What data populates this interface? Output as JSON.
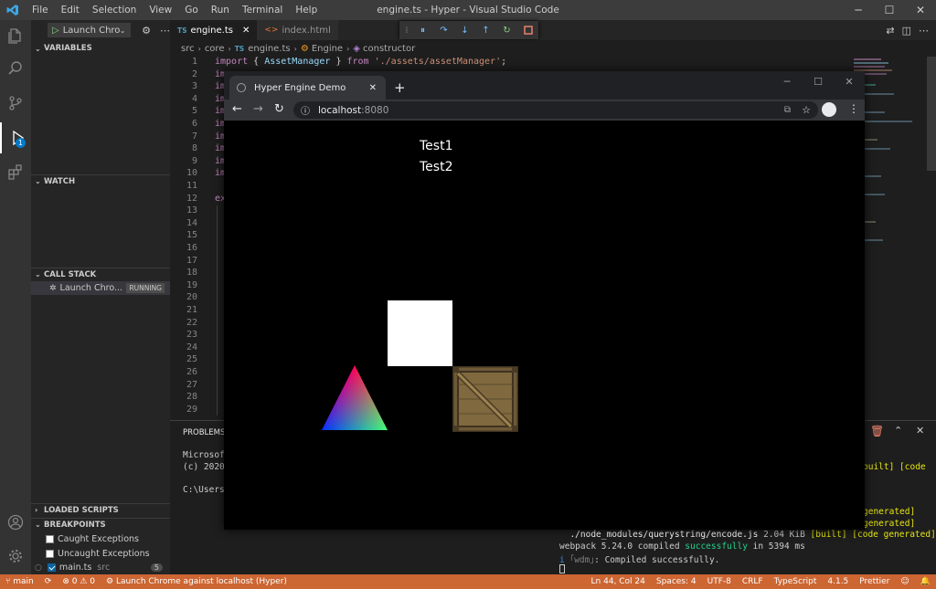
{
  "window": {
    "title": "engine.ts - Hyper - Visual Studio Code",
    "menu": [
      "File",
      "Edit",
      "Selection",
      "View",
      "Go",
      "Run",
      "Terminal",
      "Help"
    ]
  },
  "activity": {
    "icons": [
      "files-icon",
      "search-icon",
      "source-control-icon",
      "run-debug-icon",
      "extensions-icon"
    ],
    "debug_badge": "1"
  },
  "sidebar": {
    "launch_config": "Launch Chrom",
    "sections": {
      "variables": "VARIABLES",
      "watch": "WATCH",
      "call_stack": "CALL STACK",
      "loaded_scripts": "LOADED SCRIPTS",
      "breakpoints": "BREAKPOINTS"
    },
    "call_stack_item": {
      "label": "Launch Chro...",
      "status": "RUNNING"
    },
    "breakpoints": [
      {
        "label": "Caught Exceptions",
        "checked": false
      },
      {
        "label": "Uncaught Exceptions",
        "checked": false
      },
      {
        "label": "main.ts",
        "detail": "src",
        "count": "5",
        "checked": true
      }
    ]
  },
  "tabs": [
    {
      "label": "engine.ts",
      "icon": "TS",
      "active": true
    },
    {
      "label": "index.html",
      "icon": "<>",
      "active": false
    }
  ],
  "breadcrumb": [
    "src",
    "core",
    "engine.ts",
    "Engine",
    "constructor"
  ],
  "editor": {
    "line_numbers": [
      "1",
      "2",
      "3",
      "4",
      "5",
      "6",
      "7",
      "8",
      "9",
      "10",
      "11",
      "12",
      "13",
      "14",
      "15",
      "16",
      "17",
      "18",
      "19",
      "20",
      "21",
      "22",
      "23",
      "24",
      "25",
      "26",
      "27",
      "28",
      "29"
    ],
    "line1": {
      "kw": "import",
      "p1": " { ",
      "id": "AssetManager",
      "p2": " } ",
      "from": "from",
      "str": " './assets/assetManager'",
      "end": ";"
    },
    "line_im": "im",
    "line_ex": "ex"
  },
  "panel": {
    "tab": "PROBLEMS",
    "terminal": {
      "ms1": "Microsoft",
      "ms2": "(c) 2020",
      "cwd": "C:\\Users\\",
      "built": "built] [code",
      "gen1": "generated]",
      "gen2": "generated]",
      "qs_path": "  ./node_modules/querystring/encode.js",
      "qs_size": " 2.04 KiB ",
      "qs_tags": "[built] [code generated]",
      "wp_pre": "webpack 5.24.0 compiled ",
      "wp_ok": "successfully",
      "wp_post": " in 5394 ms",
      "wdm_i": "i",
      "wdm": " ｢wdm｣",
      "wdm_msg": ": Compiled successfully."
    }
  },
  "statusbar": {
    "branch": "main",
    "errors": "0",
    "warnings": "0",
    "launch": "Launch Chrome against localhost (Hyper)",
    "position": "Ln 44, Col 24",
    "spaces": "Spaces: 4",
    "encoding": "UTF-8",
    "eol": "CRLF",
    "language": "TypeScript",
    "ts_version": "4.1.5",
    "formatter": "Prettier"
  },
  "browser": {
    "tab_title": "Hyper Engine Demo",
    "url_host": "localhost",
    "url_port": ":8080",
    "text1": "Test1",
    "text2": "Test2"
  },
  "colors": {
    "statusbar": "#cc6633",
    "editor_bg": "#1e1e1e",
    "sidebar_bg": "#252526",
    "activity_bg": "#333333",
    "canvas_bg": "#000000"
  }
}
